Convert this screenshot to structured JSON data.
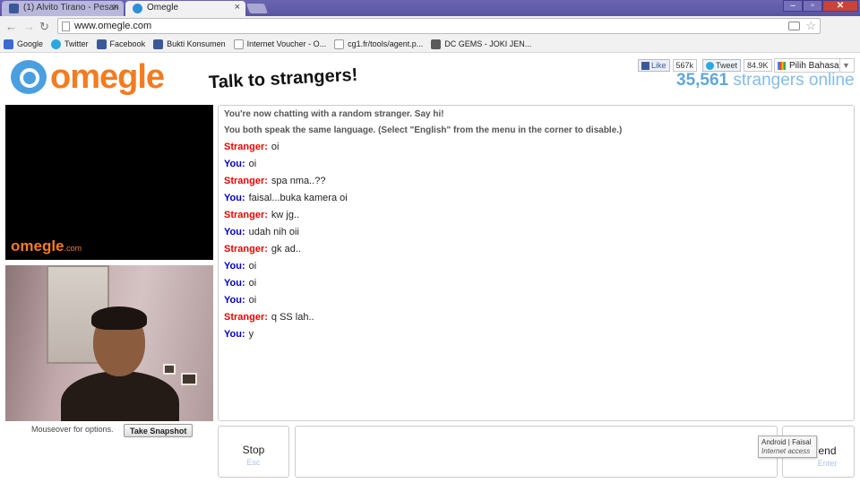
{
  "browser": {
    "tabs": [
      {
        "title": "(1) Alvito Tirano - Pesan",
        "active": false
      },
      {
        "title": "Omegle",
        "active": true
      }
    ],
    "url": "www.omegle.com",
    "bookmarks": [
      {
        "label": "Google",
        "icon": "google-icon"
      },
      {
        "label": "Twitter",
        "icon": "twitter-icon"
      },
      {
        "label": "Facebook",
        "icon": "facebook-icon"
      },
      {
        "label": "Bukti Konsumen",
        "icon": "facebook-icon"
      },
      {
        "label": "Internet Voucher - O...",
        "icon": "page-icon"
      },
      {
        "label": "cg1.fr/tools/agent.p...",
        "icon": "page-icon"
      },
      {
        "label": "DC GEMS - JOKI JEN...",
        "icon": "game-icon"
      }
    ]
  },
  "header": {
    "logo": "omegle",
    "tagline": "Talk to strangers!",
    "facebook_like": {
      "label": "Like",
      "count": "567k"
    },
    "tweet": {
      "label": "Tweet",
      "count": "84.9K"
    },
    "language": "Pilih Bahasa",
    "online_count": "35,561",
    "online_label": "strangers online"
  },
  "video": {
    "watermark": "omegle",
    "watermark_suffix": ".com",
    "mouseover_text": "Mouseover for options.",
    "snapshot_label": "Take Snapshot"
  },
  "chat": {
    "status": [
      "You're now chatting with a random stranger. Say hi!",
      "You both speak the same language. (Select \"English\" from the menu in the corner to disable.)"
    ],
    "messages": [
      {
        "from": "Stranger:",
        "text": "oi"
      },
      {
        "from": "You:",
        "text": "oi"
      },
      {
        "from": "Stranger:",
        "text": "spa nma..??"
      },
      {
        "from": "You:",
        "text": "faisal...buka kamera oi"
      },
      {
        "from": "Stranger:",
        "text": "kw jg.."
      },
      {
        "from": "You:",
        "text": "udah nih oii"
      },
      {
        "from": "Stranger:",
        "text": "gk ad.."
      },
      {
        "from": "You:",
        "text": "oi"
      },
      {
        "from": "You:",
        "text": "oi"
      },
      {
        "from": "You:",
        "text": "oi"
      },
      {
        "from": "Stranger:",
        "text": "q SS lah.."
      },
      {
        "from": "You:",
        "text": "y"
      }
    ]
  },
  "controls": {
    "stop_label": "Stop",
    "stop_hint": "Esc",
    "send_label": "end",
    "send_hint": "Enter",
    "tooltip_title": "Android | Faisal",
    "tooltip_sub": "Internet access"
  },
  "colors": {
    "stranger": "#e00000",
    "you": "#0000cc",
    "brand_orange": "#f37c20",
    "brand_blue": "#5fa7df"
  }
}
